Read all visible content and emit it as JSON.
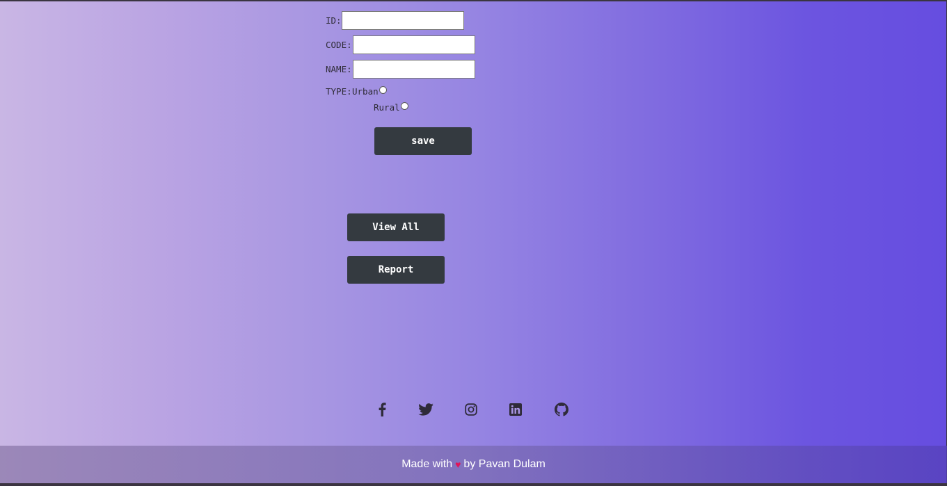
{
  "form": {
    "id_label": "ID:",
    "code_label": "CODE:",
    "name_label": "NAME:",
    "type_label": "TYPE:",
    "urban_label": "Urban",
    "rural_label": "Rural",
    "id_value": "",
    "code_value": "",
    "name_value": "",
    "save_label": "save"
  },
  "actions": {
    "view_all_label": "View All",
    "report_label": "Report"
  },
  "social": {
    "icon_color": "#2f2b3a",
    "icons": [
      "facebook-icon",
      "twitter-icon",
      "instagram-icon",
      "linkedin-icon",
      "github-icon"
    ]
  },
  "footer": {
    "made_with": "Made with",
    "heart": "♥",
    "by_author": "by Pavan Dulam",
    "heart_color": "#e0155a"
  }
}
